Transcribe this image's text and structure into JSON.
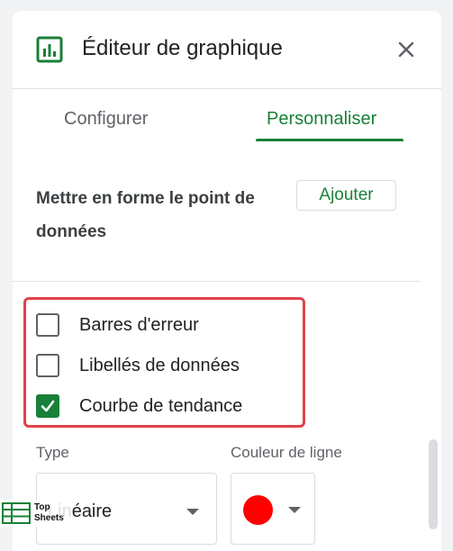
{
  "header": {
    "title": "Éditeur de graphique",
    "icon": "chart-icon",
    "close_icon": "close-icon"
  },
  "tabs": [
    {
      "label": "Configurer",
      "active": false
    },
    {
      "label": "Personnaliser",
      "active": true
    }
  ],
  "data_point": {
    "label_line1": "Mettre en forme le point de",
    "label_line2": "données",
    "add_button": "Ajouter"
  },
  "options": [
    {
      "label": "Barres d'erreur",
      "checked": false
    },
    {
      "label": "Libellés de données",
      "checked": false
    },
    {
      "label": "Courbe de tendance",
      "checked": true
    }
  ],
  "trendline": {
    "type_label": "Type",
    "type_value": "Linéaire",
    "color_label": "Couleur de ligne",
    "color_value": "#ff0000"
  },
  "watermark": {
    "line1": "Top",
    "line2": "Sheets"
  },
  "colors": {
    "accent": "#188038",
    "highlight": "#e0434b"
  }
}
